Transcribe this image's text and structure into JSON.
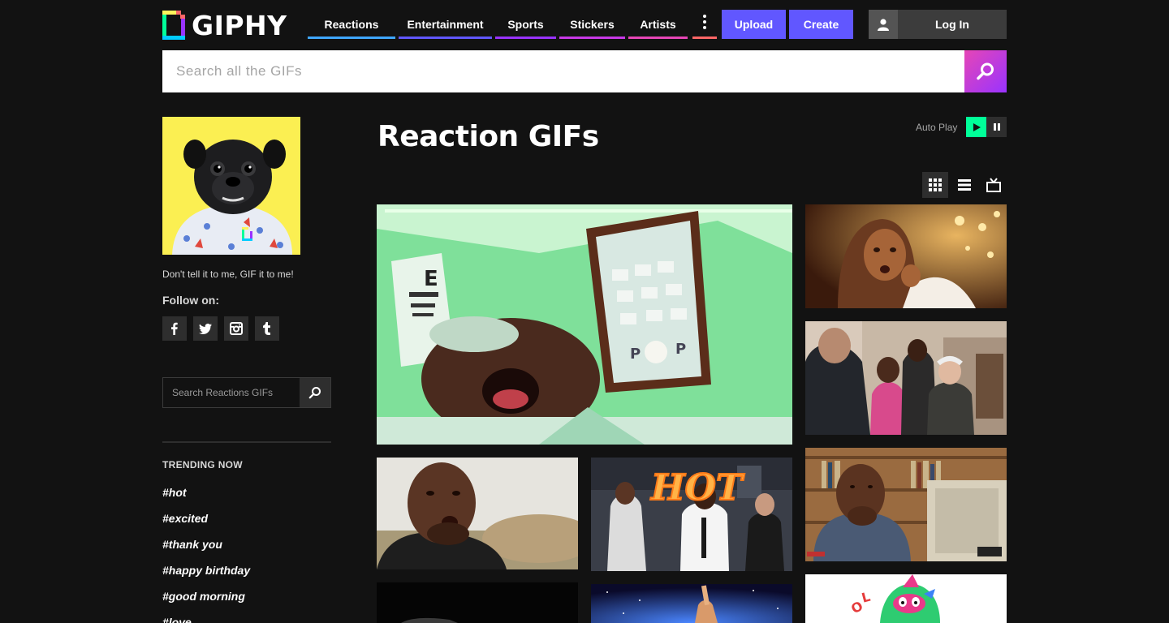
{
  "header": {
    "logo_text": "GIPHY",
    "nav": [
      {
        "label": "Reactions",
        "color": "#3fa6ff"
      },
      {
        "label": "Entertainment",
        "color": "#6157ff"
      },
      {
        "label": "Sports",
        "color": "#9933ff"
      },
      {
        "label": "Stickers",
        "color": "#c739e6"
      },
      {
        "label": "Artists",
        "color": "#e646b6"
      }
    ],
    "more_color": "#ff6666",
    "upload_label": "Upload",
    "create_label": "Create",
    "login_label": "Log In"
  },
  "search": {
    "placeholder": "Search all the GIFs"
  },
  "sidebar": {
    "tagline": "Don't tell it to me, GIF it to me!",
    "follow_label": "Follow on:",
    "social": [
      {
        "name": "facebook",
        "glyph": "f"
      },
      {
        "name": "twitter",
        "glyph": "t"
      },
      {
        "name": "instagram",
        "glyph": "◘"
      },
      {
        "name": "tumblr",
        "glyph": "t"
      }
    ],
    "search_placeholder": "Search Reactions GIFs",
    "trending_title": "TRENDING NOW",
    "trending": [
      "#hot",
      "#excited",
      "#thank you",
      "#happy birthday",
      "#good morning",
      "#love"
    ]
  },
  "main": {
    "title": "Reaction GIFs",
    "autoplay_label": "Auto Play",
    "gif_texts": {
      "hot_label": "HOT"
    }
  },
  "colors": {
    "accent": "#6157ff",
    "play": "#00ff99",
    "bg": "#121212"
  }
}
